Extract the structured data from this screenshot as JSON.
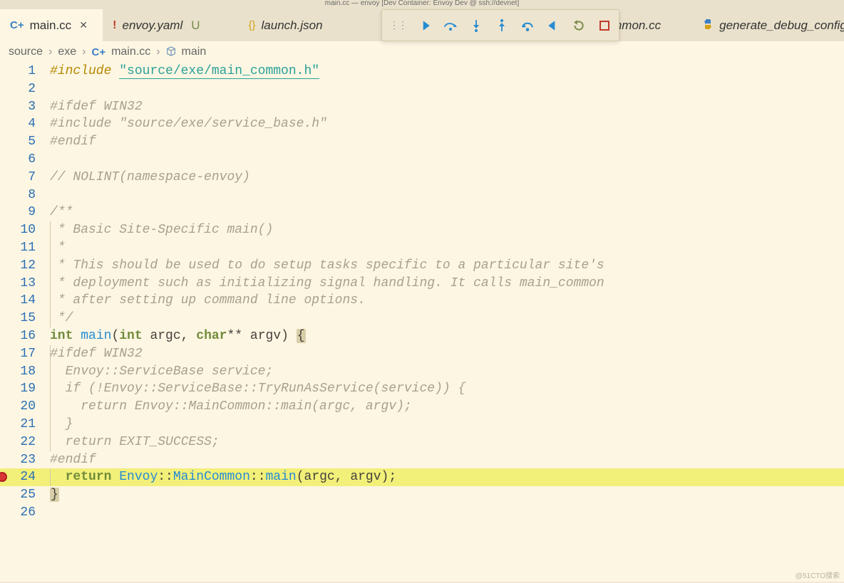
{
  "title_bar": "main.cc — envoy [Dev Container: Envoy Dev @ ssh://devnet]",
  "tabs": [
    {
      "icon": "C+",
      "label": "main.cc",
      "active": true,
      "closable": true
    },
    {
      "icon": "!",
      "label": "envoy.yaml",
      "modified": "U"
    },
    {
      "icon": "{}",
      "label": "launch.json"
    },
    {
      "icon": "C+",
      "label": "mmon.cc",
      "partial": true
    },
    {
      "icon": "py",
      "label": "generate_debug_config",
      "partial": true
    }
  ],
  "debug_toolbar": {
    "buttons": [
      "continue",
      "step-over",
      "step-into",
      "step-out",
      "step-back",
      "reverse",
      "restart",
      "stop"
    ]
  },
  "breadcrumb": {
    "segments": [
      "source",
      "exe"
    ],
    "file_icon": "C+",
    "file": "main.cc",
    "symbol_icon": "cube",
    "symbol": "main"
  },
  "code": {
    "lines": [
      {
        "n": 1,
        "tokens": [
          [
            "pp",
            "#include "
          ],
          [
            "str-u",
            "\"source/exe/main_common.h\""
          ]
        ]
      },
      {
        "n": 2,
        "tokens": []
      },
      {
        "n": 3,
        "tokens": [
          [
            "pp-dim",
            "#ifdef WIN32"
          ]
        ]
      },
      {
        "n": 4,
        "tokens": [
          [
            "pp-dim",
            "#include \"source/exe/service_base.h\""
          ]
        ]
      },
      {
        "n": 5,
        "tokens": [
          [
            "pp-dim",
            "#endif"
          ]
        ]
      },
      {
        "n": 6,
        "tokens": []
      },
      {
        "n": 7,
        "tokens": [
          [
            "cmt",
            "// NOLINT(namespace-envoy)"
          ]
        ]
      },
      {
        "n": 8,
        "tokens": []
      },
      {
        "n": 9,
        "tokens": [
          [
            "cmt",
            "/**"
          ]
        ]
      },
      {
        "n": 10,
        "guide": 1,
        "tokens": [
          [
            "cmt",
            " * Basic Site-Specific main()"
          ]
        ]
      },
      {
        "n": 11,
        "guide": 1,
        "tokens": [
          [
            "cmt",
            " *"
          ]
        ]
      },
      {
        "n": 12,
        "guide": 1,
        "tokens": [
          [
            "cmt",
            " * This should be used to do setup tasks specific to a particular site's"
          ]
        ]
      },
      {
        "n": 13,
        "guide": 1,
        "tokens": [
          [
            "cmt",
            " * deployment such as initializing signal handling. It calls main_common"
          ]
        ]
      },
      {
        "n": 14,
        "guide": 1,
        "tokens": [
          [
            "cmt",
            " * after setting up command line options."
          ]
        ]
      },
      {
        "n": 15,
        "guide": 1,
        "tokens": [
          [
            "cmt",
            " */"
          ]
        ]
      },
      {
        "n": 16,
        "tokens": [
          [
            "kw",
            "int"
          ],
          [
            "plain",
            " "
          ],
          [
            "fn",
            "main"
          ],
          [
            "plain",
            "("
          ],
          [
            "kw",
            "int"
          ],
          [
            "plain",
            " argc, "
          ],
          [
            "kw",
            "char"
          ],
          [
            "plain",
            "** argv) "
          ],
          [
            "brace",
            "{"
          ]
        ]
      },
      {
        "n": 17,
        "guide": 1,
        "tokens": [
          [
            "pp-dim",
            "#ifdef WIN32"
          ]
        ]
      },
      {
        "n": 18,
        "guide": 1,
        "tokens": [
          [
            "cmt",
            "  Envoy::ServiceBase service;"
          ]
        ]
      },
      {
        "n": 19,
        "guide": 1,
        "tokens": [
          [
            "cmt",
            "  if (!Envoy::ServiceBase::TryRunAsService(service)) {"
          ]
        ]
      },
      {
        "n": 20,
        "guide": 2,
        "tokens": [
          [
            "cmt",
            "    return Envoy::MainCommon::main(argc, argv);"
          ]
        ]
      },
      {
        "n": 21,
        "guide": 1,
        "tokens": [
          [
            "cmt",
            "  }"
          ]
        ]
      },
      {
        "n": 22,
        "guide": 1,
        "tokens": [
          [
            "cmt",
            "  return EXIT_SUCCESS;"
          ]
        ]
      },
      {
        "n": 23,
        "tokens": [
          [
            "pp-dim",
            "#endif"
          ]
        ]
      },
      {
        "n": 24,
        "highlight": true,
        "breakpoint": true,
        "guide": 1,
        "tokens": [
          [
            "plain",
            "  "
          ],
          [
            "kw",
            "return"
          ],
          [
            "plain",
            " "
          ],
          [
            "ns",
            "Envoy"
          ],
          [
            "plain",
            "::"
          ],
          [
            "ns",
            "MainCommon"
          ],
          [
            "plain",
            "::"
          ],
          [
            "fn",
            "main"
          ],
          [
            "plain",
            "(argc, argv);"
          ]
        ]
      },
      {
        "n": 25,
        "tokens": [
          [
            "brace",
            "}"
          ]
        ]
      },
      {
        "n": 26,
        "tokens": []
      }
    ]
  },
  "watermark": "@51CTO搜索"
}
